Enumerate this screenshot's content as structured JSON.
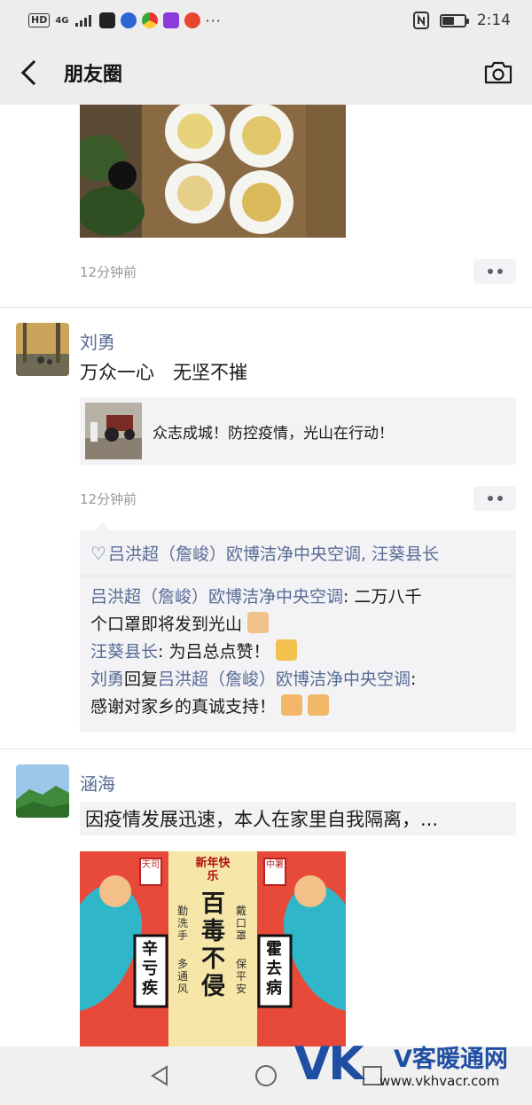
{
  "status_bar": {
    "left_badges": [
      "HD",
      "4G"
    ],
    "time": "2:14",
    "battery_level": 0.55,
    "icons": [
      "signal-icon",
      "app-icon-c",
      "baidu-icon",
      "chrome-icon",
      "video-icon",
      "weibo-icon",
      "more-dots-icon",
      "nfc-icon",
      "battery-icon"
    ]
  },
  "header": {
    "title": "朋友圈"
  },
  "posts": [
    {
      "time": "12分钟前"
    },
    {
      "author": "刘勇",
      "text": "万众一心　无坚不摧",
      "link_title": "众志成城！防控疫情，光山在行动！",
      "time": "12分钟前",
      "likes": "吕洪超（詹峻）欧博洁净中央空调, 汪葵县长",
      "comments": [
        {
          "user": "吕洪超（詹峻）欧博洁净中央空调",
          "sep": ": ",
          "text_line1": "二万八千",
          "text_line2": "个口罩即将发到光山"
        },
        {
          "user": "汪葵县长",
          "sep": ": ",
          "text": "为吕总点赞！"
        },
        {
          "user": "刘勇",
          "reply_word": "回复",
          "reply_to": "吕洪超（詹峻）欧博洁净中央空调",
          "sep": ":",
          "text": "感谢对家乡的真诚支持！"
        }
      ]
    },
    {
      "author": "涵海",
      "text": "因疫情发展迅速，本人在家里自我隔离，..."
    }
  ],
  "poster_text": {
    "top": "新年快乐",
    "center": "百毒不侵",
    "left_banner": "辛亏疾",
    "right_banner": "霍去病",
    "left_small": "勤洗手",
    "left_small2": "多通风",
    "right_small": "戴口罩",
    "right_small2": "保平安",
    "tag_left": "天司",
    "tag_right": "中署"
  },
  "watermark": {
    "logo": "VK",
    "name": "V客暖通网",
    "url": "www.vkhvacr.com"
  },
  "colors": {
    "link_blue": "#576b95",
    "bar_gray": "#ededed",
    "card_gray": "#f3f3f5",
    "brand_blue": "#1f4fa3"
  }
}
